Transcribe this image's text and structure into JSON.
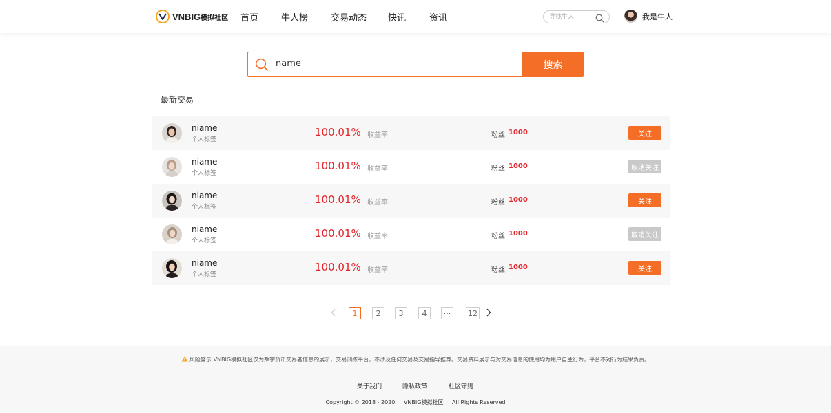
{
  "header": {
    "logo_text": "VNBIG",
    "logo_sub": "模拟社区",
    "nav": [
      {
        "label": "首页"
      },
      {
        "label": "牛人榜"
      },
      {
        "label": "交易动态"
      },
      {
        "label": "快讯"
      },
      {
        "label": "资讯"
      }
    ],
    "search_placeholder": "寻找牛人",
    "user_name": "我是牛人"
  },
  "search": {
    "value": "name",
    "button_label": "搜索"
  },
  "section_title": "最新交易",
  "rows": [
    {
      "name": "niame",
      "tag": "个人标签",
      "rate": "100.01%",
      "rate_label": "收益率",
      "fans_label": "粉丝",
      "fans": "1000",
      "button": "关注",
      "following": false
    },
    {
      "name": "niame",
      "tag": "个人标签",
      "rate": "100.01%",
      "rate_label": "收益率",
      "fans_label": "粉丝",
      "fans": "1000",
      "button": "取消关注",
      "following": true
    },
    {
      "name": "niame",
      "tag": "个人标签",
      "rate": "100.01%",
      "rate_label": "收益率",
      "fans_label": "粉丝",
      "fans": "1000",
      "button": "关注",
      "following": false
    },
    {
      "name": "niame",
      "tag": "个人标签",
      "rate": "100.01%",
      "rate_label": "收益率",
      "fans_label": "粉丝",
      "fans": "1000",
      "button": "取消关注",
      "following": true
    },
    {
      "name": "niame",
      "tag": "个人标签",
      "rate": "100.01%",
      "rate_label": "收益率",
      "fans_label": "粉丝",
      "fans": "1000",
      "button": "关注",
      "following": false
    }
  ],
  "pagination": {
    "pages": [
      "1",
      "2",
      "3",
      "4",
      "···",
      "12"
    ],
    "current": "1"
  },
  "footer": {
    "risk_warning": "风险警示:VNBIG模拟社区仅为数字货币交易者信息的展示，交易训练平台，不涉及任何交易及交易指导推荐。交易资料展示与对交易信息的使用均为用户自主行为，平台不对行为结果负责。",
    "links": [
      {
        "label": "关于我们"
      },
      {
        "label": "隐私政策"
      },
      {
        "label": "社区守则"
      }
    ],
    "copyright": "Copyright © 2018 - 2020",
    "brand": "VNBIG模拟社区",
    "rights": "All Rights Reserved"
  },
  "colors": {
    "accent": "#f56e28",
    "rate_red": "#e2262b",
    "disabled": "#c9c9c9",
    "logo_yellow": "#f6a623"
  }
}
